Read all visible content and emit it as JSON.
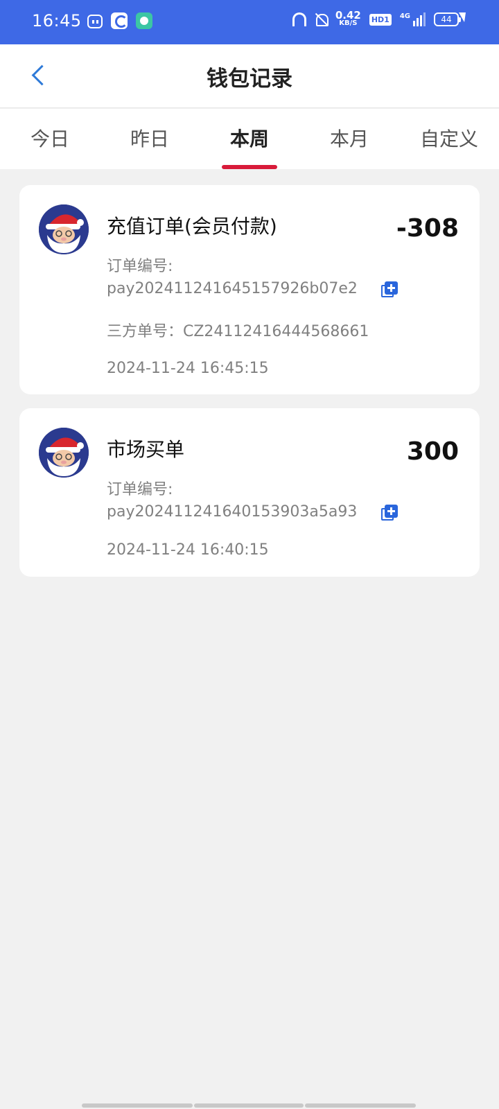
{
  "status_bar": {
    "time": "16:45",
    "net_speed_value": "0.42",
    "net_speed_unit": "KB/S",
    "hd_label": "HD1",
    "network_type": "4G",
    "battery": "44"
  },
  "header": {
    "title": "钱包记录",
    "back_icon": "chevron-left-icon"
  },
  "tabs": [
    {
      "label": "今日",
      "active": false
    },
    {
      "label": "昨日",
      "active": false
    },
    {
      "label": "本周",
      "active": true
    },
    {
      "label": "本月",
      "active": false
    },
    {
      "label": "自定义",
      "active": false
    }
  ],
  "records": [
    {
      "title": "充值订单(会员付款)",
      "amount": "-308",
      "order_label": "订单编号:",
      "order_no": "pay20241124164515792​6b07e2",
      "third_party": "三方单号：CZ24112416444568661",
      "time": "2024-11-24 16:45:15"
    },
    {
      "title": "市场买单",
      "amount": "300",
      "order_label": "订单编号:",
      "order_no": "pay20241124164015390​3a5a93",
      "time": "2024-11-24 16:40:15"
    }
  ],
  "colors": {
    "status_bar": "#3e69e6",
    "accent": "#d81b3a",
    "link": "#2a66dc"
  }
}
